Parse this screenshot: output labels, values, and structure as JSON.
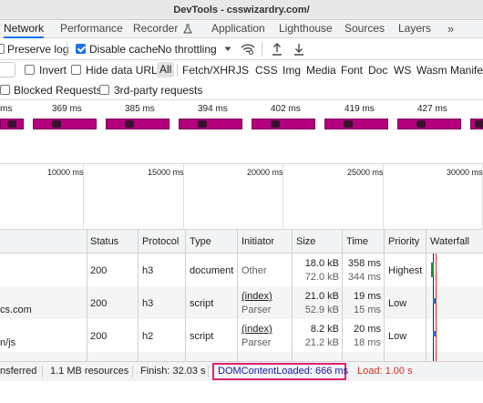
{
  "window": {
    "title": "DevTools - csswizardry.com/"
  },
  "tabs": [
    {
      "label": "Network",
      "active": true
    },
    {
      "label": "Performance"
    },
    {
      "label": "Recorder"
    },
    {
      "label": "Application"
    },
    {
      "label": "Lighthouse"
    },
    {
      "label": "Sources"
    },
    {
      "label": "Layers"
    }
  ],
  "toolbar": {
    "preserve_log": {
      "label": "Preserve log",
      "checked": false
    },
    "disable_cache": {
      "label": "Disable cache",
      "checked": true
    },
    "throttling": "No throttling"
  },
  "filters": {
    "invert": {
      "label": "Invert",
      "checked": false
    },
    "hide_data_urls": {
      "label": "Hide data URLs",
      "checked": false
    },
    "types": [
      "All",
      "Fetch/XHR",
      "JS",
      "CSS",
      "Img",
      "Media",
      "Font",
      "Doc",
      "WS",
      "Wasm",
      "Manifest"
    ],
    "selected_type": "All",
    "blocked_requests": {
      "label": "Blocked Requests",
      "checked": false
    },
    "third_party": {
      "label": "3rd-party requests",
      "checked": false
    }
  },
  "filmstrip": {
    "labels": [
      "ms",
      "369 ms",
      "385 ms",
      "394 ms",
      "402 ms",
      "419 ms",
      "427 ms"
    ]
  },
  "overview": {
    "labels": [
      "10000 ms",
      "15000 ms",
      "20000 ms",
      "25000 ms",
      "30000 ms"
    ]
  },
  "table": {
    "headers": [
      "Status",
      "Protocol",
      "Type",
      "Initiator",
      "Size",
      "Time",
      "Priority",
      "Waterfall"
    ],
    "rows": [
      {
        "name": "",
        "status": "200",
        "protocol": "h3",
        "type": "document",
        "initiator": "Other",
        "initiator_sub": "",
        "size": "18.0 kB",
        "size_sub": "72.0 kB",
        "time": "358 ms",
        "time_sub": "344 ms",
        "priority": "Highest"
      },
      {
        "name": "cs.com",
        "status": "200",
        "protocol": "h3",
        "type": "script",
        "initiator": "(index)",
        "initiator_sub": "Parser",
        "size": "21.0 kB",
        "size_sub": "52.9 kB",
        "time": "19 ms",
        "time_sub": "15 ms",
        "priority": "Low"
      },
      {
        "name": "n/js",
        "status": "200",
        "protocol": "h2",
        "type": "script",
        "initiator": "(index)",
        "initiator_sub": "Parser",
        "size": "8.2 kB",
        "size_sub": "21.2 kB",
        "time": "20 ms",
        "time_sub": "18 ms",
        "priority": "Low"
      }
    ]
  },
  "status_bar": {
    "transferred": "nsferred",
    "resources": "1.1 MB resources",
    "finish": "Finish: 32.03 s",
    "dom_content_loaded": "DOMContentLoaded: 666 ms",
    "load": "Load: 1.00 s"
  },
  "colors": {
    "accent": "#1a73e8",
    "dcl": "#1a1aa6",
    "load": "#d93025",
    "highlight_box": "#e0246b"
  }
}
